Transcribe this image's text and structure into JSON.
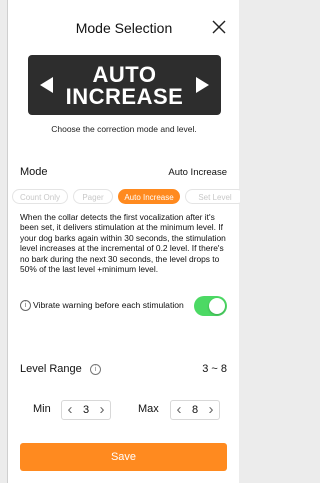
{
  "header": {
    "title": "Mode Selection",
    "close_icon": "close-icon"
  },
  "mode_banner": {
    "line1": "AUTO",
    "line2": "INCREASE",
    "prev_icon": "triangle-left-icon",
    "next_icon": "triangle-right-icon"
  },
  "hint": "Choose the correction mode and level.",
  "mode": {
    "label": "Mode",
    "value": "Auto Increase"
  },
  "chips": [
    {
      "label": "Count Only",
      "active": false
    },
    {
      "label": "Pager",
      "active": false
    },
    {
      "label": "Auto Increase",
      "active": true
    },
    {
      "label": "Set Level",
      "active": false
    }
  ],
  "description": "When the collar detects the first vocalization after it's been set, it delivers stimulation at the minimum level. If your dog barks again within 30 seconds, the stimulation level increases at the incremental of 0.2 level. If there's no bark during the next 30 seconds, the level drops to 50% of the last level +minimum level.",
  "vibrate": {
    "info_icon": "info-icon",
    "info_glyph": "i",
    "label": "Vibrate warning before each stimulation",
    "enabled": true
  },
  "level_range": {
    "label": "Level Range",
    "info_icon": "info-icon",
    "info_glyph": "i",
    "value": "3 ~ 8"
  },
  "min": {
    "label": "Min",
    "value": "3",
    "dec": "‹",
    "inc": "›"
  },
  "max": {
    "label": "Max",
    "value": "8",
    "dec": "‹",
    "inc": "›"
  },
  "save_label": "Save",
  "colors": {
    "accent": "#ff8a1f",
    "toggle_on": "#4cd964",
    "banner": "#2d2d2d"
  }
}
